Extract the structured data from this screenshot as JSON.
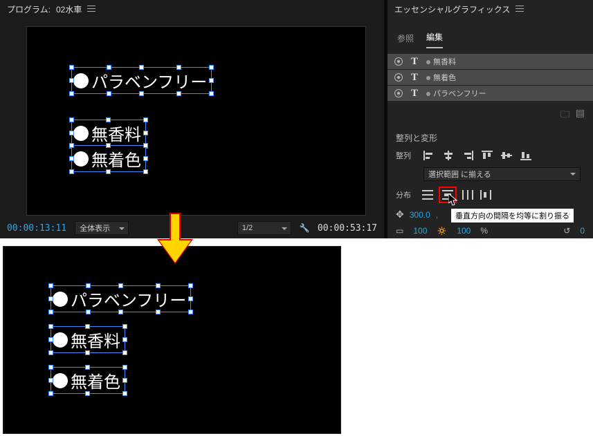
{
  "program": {
    "title_prefix": "プログラム:",
    "title_name": "02水車",
    "current_tc": "00:00:13:11",
    "duration_tc": "00:00:53:17",
    "view_mode": "全体表示",
    "zoom": "1/2",
    "layers": [
      {
        "text": "パラベンフリー"
      },
      {
        "text": "無香料"
      },
      {
        "text": "無着色"
      }
    ]
  },
  "eg": {
    "panel_title": "エッセンシャルグラフィックス",
    "tabs": {
      "browse": "参照",
      "edit": "編集"
    },
    "layers": [
      {
        "name": "無香料"
      },
      {
        "name": "無着色"
      },
      {
        "name": "パラベンフリー"
      }
    ],
    "section_title": "整列と変形",
    "align_label": "整列",
    "distribute_label": "分布",
    "align_scope": "選択範囲 に揃える",
    "tooltip": "垂直方向の間隔を均等に割り振る",
    "transform": {
      "x": "300.0",
      "scale": "100",
      "pct": "%",
      "rotation": "0",
      "opacity": "100"
    }
  },
  "result_layers": [
    {
      "text": "パラベンフリー"
    },
    {
      "text": "無香料"
    },
    {
      "text": "無着色"
    }
  ]
}
